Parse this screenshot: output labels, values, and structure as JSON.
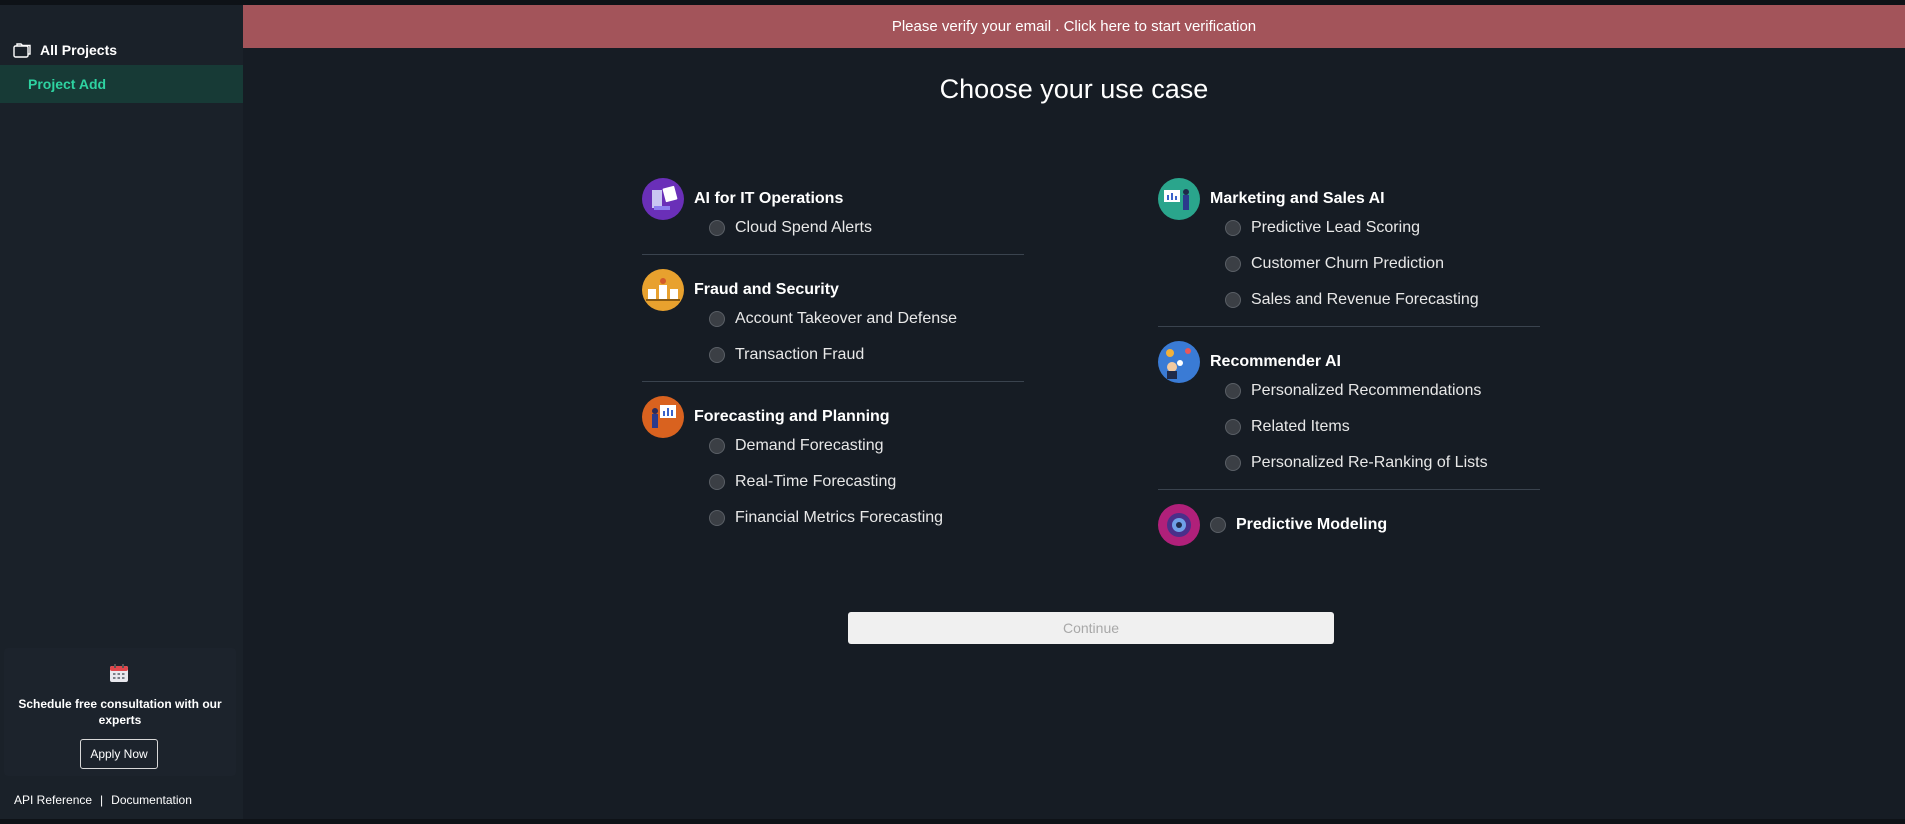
{
  "sidebar": {
    "header_label": "All Projects",
    "active_item": "Project Add",
    "consult_text": "Schedule free consultation with our experts",
    "apply_label": "Apply Now",
    "footer": {
      "api_reference": "API Reference",
      "separator": "|",
      "documentation": "Documentation"
    }
  },
  "banner": {
    "text": "Please verify your email .  Click here to start verification",
    "color": "#a3545a"
  },
  "main": {
    "title": "Choose your use case",
    "continue_label": "Continue",
    "columns": [
      {
        "categories": [
          {
            "title": "AI for IT Operations",
            "icon": "it-operations-icon",
            "color": "#6a2fb8",
            "options": [
              "Cloud Spend Alerts"
            ]
          },
          {
            "title": "Fraud and Security",
            "icon": "fraud-security-icon",
            "color": "#e8a12e",
            "options": [
              "Account Takeover and Defense",
              "Transaction Fraud"
            ]
          },
          {
            "title": "Forecasting and Planning",
            "icon": "forecasting-icon",
            "color": "#d9621f",
            "options": [
              "Demand Forecasting",
              "Real-Time Forecasting",
              "Financial Metrics Forecasting"
            ]
          }
        ]
      },
      {
        "categories": [
          {
            "title": "Marketing and Sales AI",
            "icon": "marketing-sales-icon",
            "color": "#2aa58c",
            "options": [
              "Predictive Lead Scoring",
              "Customer Churn Prediction",
              "Sales and Revenue Forecasting"
            ]
          },
          {
            "title": "Recommender AI",
            "icon": "recommender-icon",
            "color": "#3a7bd5",
            "options": [
              "Personalized Recommendations",
              "Related Items",
              "Personalized Re-Ranking of Lists"
            ]
          },
          {
            "title": "Predictive Modeling",
            "icon": "predictive-modeling-icon",
            "color": "#b0207a",
            "options": []
          }
        ]
      }
    ]
  },
  "accent_color": "#2ed3a1"
}
